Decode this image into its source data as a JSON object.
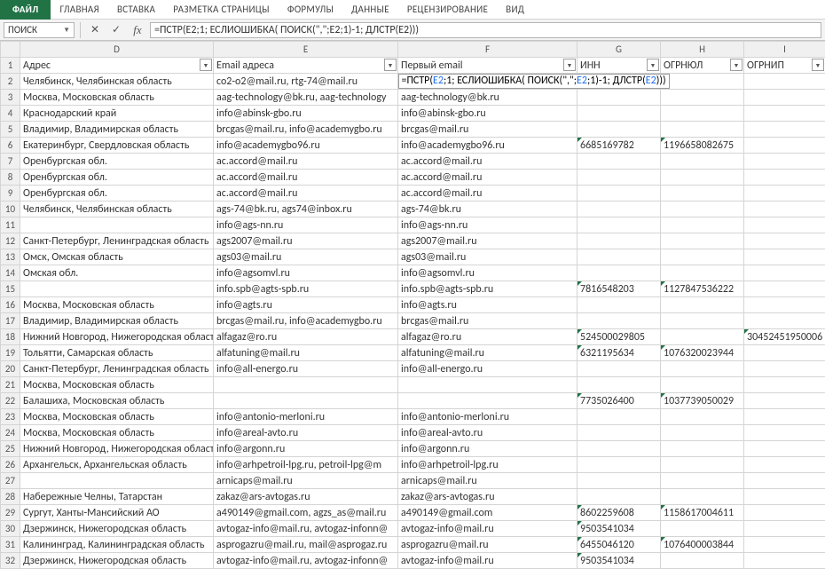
{
  "ribbon": {
    "file": "ФАЙЛ",
    "tabs": [
      "ГЛАВНАЯ",
      "ВСТАВКА",
      "РАЗМЕТКА СТРАНИЦЫ",
      "ФОРМУЛЫ",
      "ДАННЫЕ",
      "РЕЦЕНЗИРОВАНИЕ",
      "ВИД"
    ]
  },
  "formula_bar": {
    "name_box": "ПОИСК",
    "cancel": "✕",
    "enter": "✓",
    "fx": "fx",
    "formula": "=ПСТР(E2;1; ЕСЛИОШИБКА( ПОИСК(\",\";E2;1)-1; ДЛСТР(E2)))"
  },
  "columns": [
    "D",
    "E",
    "F",
    "G",
    "H",
    "I"
  ],
  "headers": {
    "D": "Адрес",
    "E": "Email адреса",
    "F": "Первый email",
    "G": "ИНН",
    "H": "ОГРНЮЛ",
    "I": "ОГРНИП"
  },
  "active_cell_formula_markup": [
    {
      "t": "=ПСТР(",
      "c": "black"
    },
    {
      "t": "E2",
      "c": "blue"
    },
    {
      "t": ";1; ЕСЛИОШИБКА( ПОИСК(\",\";",
      "c": "black"
    },
    {
      "t": "E2",
      "c": "blue"
    },
    {
      "t": ";1)-1; ДЛСТР(",
      "c": "black"
    },
    {
      "t": "E2",
      "c": "blue"
    },
    {
      "t": ")))",
      "c": "black"
    }
  ],
  "rows": [
    {
      "n": 2,
      "D": "Челябинск, Челябинская область",
      "E": "co2-o2@mail.ru, rtg-74@mail.ru",
      "F": "",
      "G": "",
      "H": "",
      "I": ""
    },
    {
      "n": 3,
      "D": "Москва, Московская область",
      "E": "aag-technology@bk.ru, aag-technology",
      "F": "aag-technology@bk.ru",
      "G": "",
      "H": "",
      "I": ""
    },
    {
      "n": 4,
      "D": "Краснодарский край",
      "E": "info@abinsk-gbo.ru",
      "F": "info@abinsk-gbo.ru",
      "G": "",
      "H": "",
      "I": ""
    },
    {
      "n": 5,
      "D": "Владимир, Владимирская область",
      "E": "brcgas@mail.ru, info@academygbo.ru",
      "F": "brcgas@mail.ru",
      "G": "",
      "H": "",
      "I": ""
    },
    {
      "n": 6,
      "D": "Екатеринбург, Свердловская область",
      "E": "info@academygbo96.ru",
      "F": "info@academygbo96.ru",
      "G": "6685169782",
      "H": "1196658082675",
      "I": ""
    },
    {
      "n": 7,
      "D": "Оренбургская обл.",
      "E": "ac.accord@mail.ru",
      "F": "ac.accord@mail.ru",
      "G": "",
      "H": "",
      "I": ""
    },
    {
      "n": 8,
      "D": "Оренбургская обл.",
      "E": "ac.accord@mail.ru",
      "F": "ac.accord@mail.ru",
      "G": "",
      "H": "",
      "I": ""
    },
    {
      "n": 9,
      "D": "Оренбургская обл.",
      "E": "ac.accord@mail.ru",
      "F": "ac.accord@mail.ru",
      "G": "",
      "H": "",
      "I": ""
    },
    {
      "n": 10,
      "D": "Челябинск, Челябинская область",
      "E": "ags-74@bk.ru, ags74@inbox.ru",
      "F": "ags-74@bk.ru",
      "G": "",
      "H": "",
      "I": ""
    },
    {
      "n": 11,
      "D": "",
      "E": "info@ags-nn.ru",
      "F": "info@ags-nn.ru",
      "G": "",
      "H": "",
      "I": ""
    },
    {
      "n": 12,
      "D": "Санкт-Петербург, Ленинградская область",
      "E": "ags2007@mail.ru",
      "F": "ags2007@mail.ru",
      "G": "",
      "H": "",
      "I": ""
    },
    {
      "n": 13,
      "D": "Омск, Омская область",
      "E": "ags03@mail.ru",
      "F": "ags03@mail.ru",
      "G": "",
      "H": "",
      "I": ""
    },
    {
      "n": 14,
      "D": "Омская обл.",
      "E": "info@agsomvl.ru",
      "F": "info@agsomvl.ru",
      "G": "",
      "H": "",
      "I": ""
    },
    {
      "n": 15,
      "D": "",
      "E": "info.spb@agts-spb.ru",
      "F": "info.spb@agts-spb.ru",
      "G": "7816548203",
      "H": "1127847536222",
      "I": ""
    },
    {
      "n": 16,
      "D": "Москва, Московская область",
      "E": "info@agts.ru",
      "F": "info@agts.ru",
      "G": "",
      "H": "",
      "I": ""
    },
    {
      "n": 17,
      "D": "Владимир, Владимирская область",
      "E": "brcgas@mail.ru, info@academygbo.ru",
      "F": "brcgas@mail.ru",
      "G": "",
      "H": "",
      "I": ""
    },
    {
      "n": 18,
      "D": "Нижний Новгород, Нижегородская область",
      "E": "alfagaz@ro.ru",
      "F": "alfagaz@ro.ru",
      "G": "524500029805",
      "H": "",
      "I": "30452451950006"
    },
    {
      "n": 19,
      "D": "Тольятти, Самарская область",
      "E": "alfatuning@mail.ru",
      "F": "alfatuning@mail.ru",
      "G": "6321195634",
      "H": "1076320023944",
      "I": ""
    },
    {
      "n": 20,
      "D": "Санкт-Петербург, Ленинградская область",
      "E": "info@all-energo.ru",
      "F": "info@all-energo.ru",
      "G": "",
      "H": "",
      "I": ""
    },
    {
      "n": 21,
      "D": "Москва, Московская область",
      "E": "",
      "F": "",
      "G": "",
      "H": "",
      "I": ""
    },
    {
      "n": 22,
      "D": "Балашиха, Московская область",
      "E": "",
      "F": "",
      "G": "7735026400",
      "H": "1037739050029",
      "I": ""
    },
    {
      "n": 23,
      "D": "Москва, Московская область",
      "E": "info@antonio-merloni.ru",
      "F": "info@antonio-merloni.ru",
      "G": "",
      "H": "",
      "I": ""
    },
    {
      "n": 24,
      "D": "Москва, Московская область",
      "E": "info@areal-avto.ru",
      "F": "info@areal-avto.ru",
      "G": "",
      "H": "",
      "I": ""
    },
    {
      "n": 25,
      "D": "Нижний Новгород, Нижегородская область",
      "E": "info@argonn.ru",
      "F": "info@argonn.ru",
      "G": "",
      "H": "",
      "I": ""
    },
    {
      "n": 26,
      "D": "Архангельск, Архангельская область",
      "E": "info@arhpetroil-lpg.ru, petroil-lpg@m",
      "F": "info@arhpetroil-lpg.ru",
      "G": "",
      "H": "",
      "I": ""
    },
    {
      "n": 27,
      "D": "",
      "E": "arnicaps@mail.ru",
      "F": "arnicaps@mail.ru",
      "G": "",
      "H": "",
      "I": ""
    },
    {
      "n": 28,
      "D": "Набережные Челны, Татарстан",
      "E": "zakaz@ars-avtogas.ru",
      "F": "zakaz@ars-avtogas.ru",
      "G": "",
      "H": "",
      "I": ""
    },
    {
      "n": 29,
      "D": "Сургут, Ханты-Мансийский АО",
      "E": "a490149@gmail.com, agzs_as@mail.ru",
      "F": "a490149@gmail.com",
      "G": "8602259608",
      "H": "1158617004611",
      "I": ""
    },
    {
      "n": 30,
      "D": "Дзержинск, Нижегородская область",
      "E": "avtogaz-info@mail.ru, avtogaz-infonn@",
      "F": "avtogaz-info@mail.ru",
      "G": "9503541034",
      "H": "",
      "I": ""
    },
    {
      "n": 31,
      "D": "Калининград, Калининградская область",
      "E": "asprogazru@mail.ru, mail@asprogaz.ru",
      "F": "asprogazru@mail.ru",
      "G": "6455046120",
      "H": "1076400003844",
      "I": ""
    },
    {
      "n": 32,
      "D": "Дзержинск, Нижегородская область",
      "E": "avtogaz-info@mail.ru, avtogaz-infonn@",
      "F": "avtogaz-info@mail.ru",
      "G": "9503541034",
      "H": "",
      "I": ""
    }
  ],
  "chart_data": null
}
